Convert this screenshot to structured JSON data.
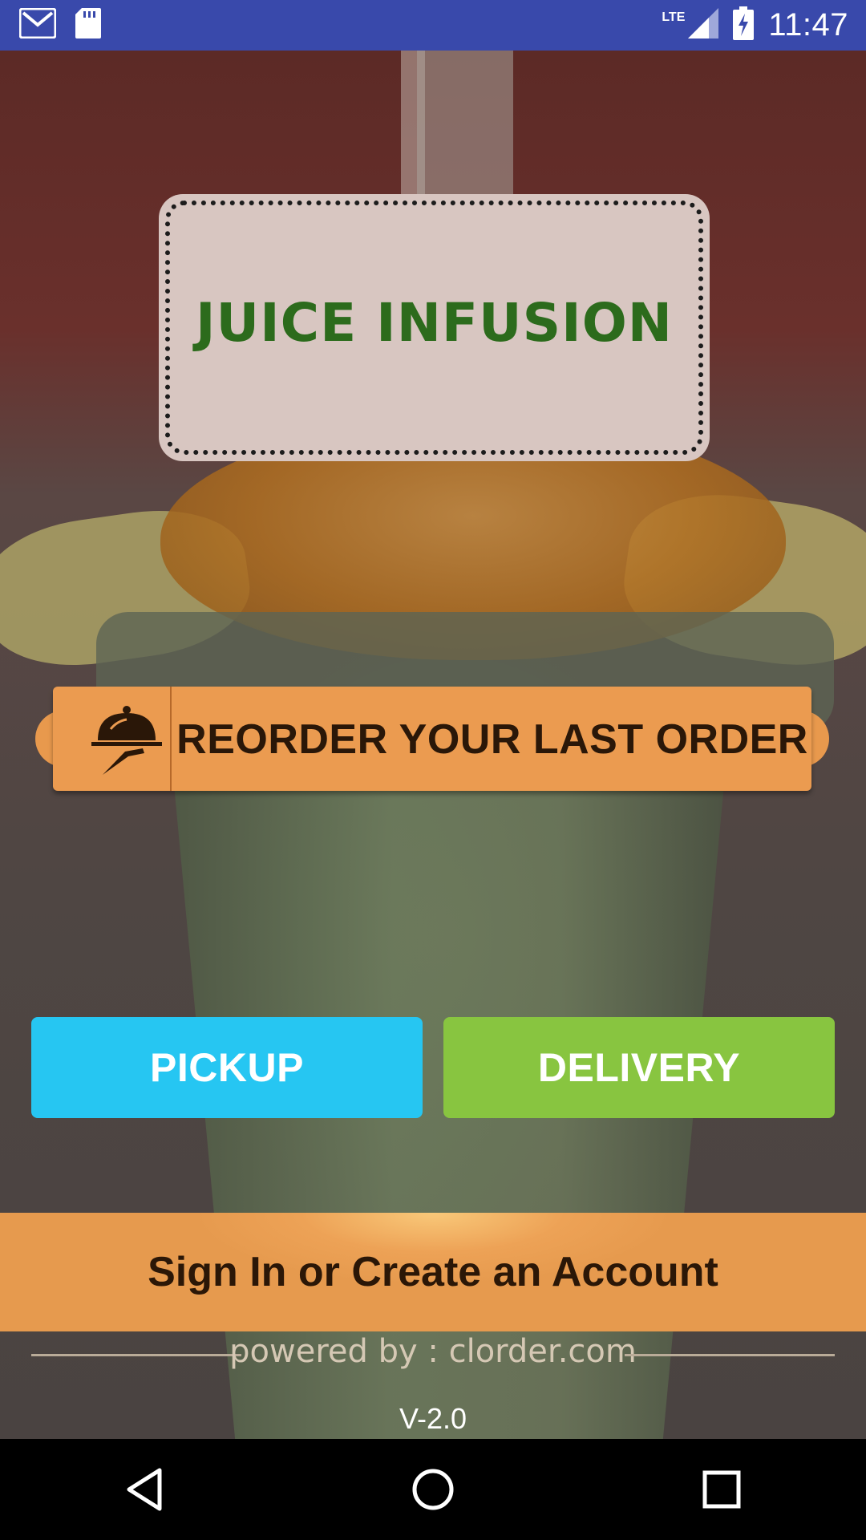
{
  "status_bar": {
    "time": "11:47",
    "network": "LTE",
    "icons": [
      "gmail-icon",
      "sd-card-icon",
      "signal-icon",
      "battery-charging-icon"
    ]
  },
  "logo": {
    "text": "JUICE INFUSION"
  },
  "reorder": {
    "label": "REORDER YOUR LAST ORDER",
    "icon": "serving-cloche-icon"
  },
  "buttons": {
    "pickup": "PICKUP",
    "delivery": "DELIVERY"
  },
  "signin": {
    "label": "Sign In or Create an Account"
  },
  "footer": {
    "powered_by": "powered by : clorder.com",
    "version": "V-2.0"
  },
  "nav": {
    "icons": [
      "back-icon",
      "home-icon",
      "recents-icon"
    ]
  },
  "colors": {
    "status_bar": "#3949ab",
    "pickup": "#26c6f2",
    "delivery": "#88c540",
    "accent_orange": "#eb9b50",
    "logo_green": "#2c6b1c"
  }
}
